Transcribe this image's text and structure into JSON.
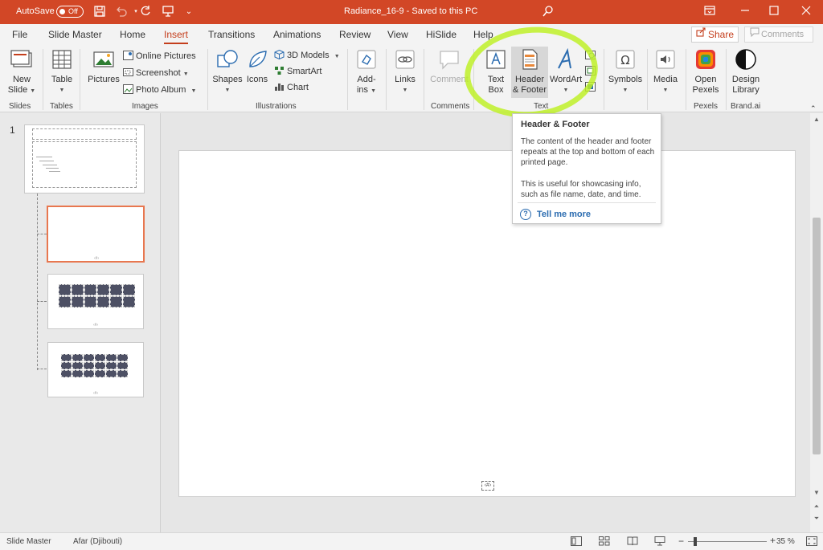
{
  "titlebar": {
    "autosave_label": "AutoSave",
    "autosave_state": "Off",
    "document_title": "Radiance_16-9  -  Saved to this PC"
  },
  "tabs": [
    "File",
    "Slide Master",
    "Home",
    "Insert",
    "Transitions",
    "Animations",
    "Review",
    "View",
    "HiSlide",
    "Help"
  ],
  "active_tab": "Insert",
  "share_label": "Share",
  "comments_label": "Comments",
  "ribbon": {
    "slides": {
      "new_slide_line1": "New",
      "new_slide_line2": "Slide",
      "group": "Slides"
    },
    "tables": {
      "table": "Table",
      "group": "Tables"
    },
    "images": {
      "pictures": "Pictures",
      "online_pictures": "Online Pictures",
      "screenshot": "Screenshot",
      "photo_album": "Photo Album",
      "group": "Images"
    },
    "illustrations": {
      "shapes": "Shapes",
      "icons": "Icons",
      "models": "3D Models",
      "smartart": "SmartArt",
      "chart": "Chart",
      "group": "Illustrations"
    },
    "addins": {
      "line1": "Add-",
      "line2": "ins"
    },
    "links": {
      "label": "Links"
    },
    "comments": {
      "comment": "Comment",
      "group": "Comments"
    },
    "text": {
      "textbox_line1": "Text",
      "textbox_line2": "Box",
      "hf_line1": "Header",
      "hf_line2": "& Footer",
      "wordart": "WordArt",
      "group": "Text"
    },
    "symbols": {
      "label": "Symbols"
    },
    "media": {
      "label": "Media"
    },
    "pexels": {
      "line1": "Open",
      "line2": "Pexels",
      "group": "Pexels"
    },
    "brand": {
      "line1": "Design",
      "line2": "Library",
      "group": "Brand.ai"
    }
  },
  "thumbnails": {
    "slide_number": "1"
  },
  "slide": {
    "number_placeholder": "‹#›"
  },
  "tooltip": {
    "title": "Header & Footer",
    "p1": "The content of the header and footer repeats at the top and bottom of each printed page.",
    "p2": "This is useful for showcasing info, such as file name, date, and time.",
    "link": "Tell me more"
  },
  "statusbar": {
    "view": "Slide Master",
    "language": "Afar (Djibouti)",
    "zoom_out": "−",
    "zoom_in": "+",
    "zoom": "35 %",
    "zoom_fraction": 0.35
  },
  "colors": {
    "accent": "#d24726",
    "tab_active": "#c43e1c",
    "marker": "#bef028",
    "link": "#2b6cb0"
  }
}
